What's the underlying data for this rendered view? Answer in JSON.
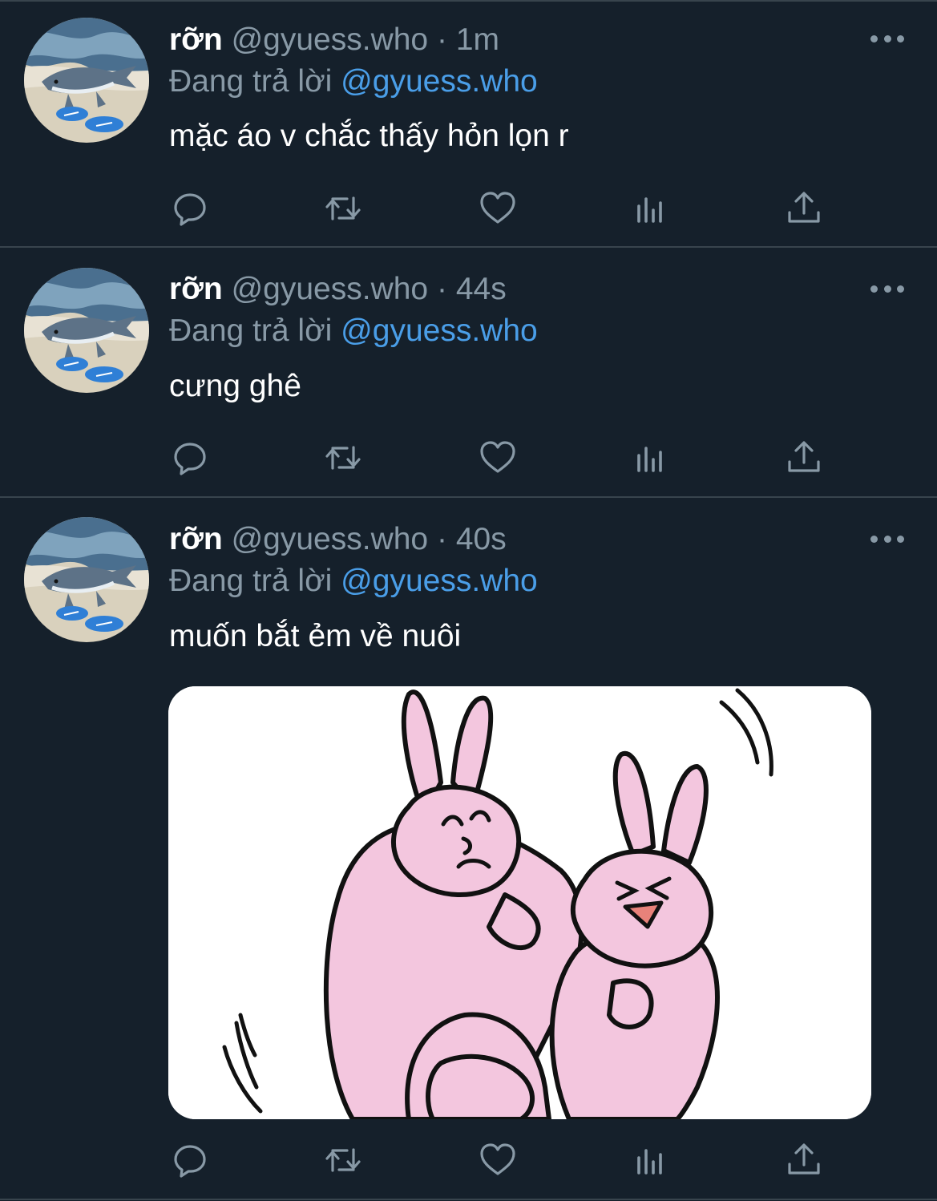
{
  "tweets": [
    {
      "name": "rỡn",
      "handle": "@gyuess.who",
      "sep": "·",
      "time": "1m",
      "replying_prefix": "Đang trả lời",
      "replying_to": "@gyuess.who",
      "text": "mặc áo v chắc thấy hỏn lọn r"
    },
    {
      "name": "rỡn",
      "handle": "@gyuess.who",
      "sep": "·",
      "time": "44s",
      "replying_prefix": "Đang trả lời",
      "replying_to": "@gyuess.who",
      "text": "cưng ghê"
    },
    {
      "name": "rỡn",
      "handle": "@gyuess.who",
      "sep": "·",
      "time": "40s",
      "replying_prefix": "Đang trả lời",
      "replying_to": "@gyuess.who",
      "text": "muốn bắt ẻm về nuôi",
      "media": "pink-bunnies-sticker"
    }
  ],
  "action_icons": [
    "reply-icon",
    "retweet-icon",
    "like-icon",
    "analytics-icon",
    "share-icon"
  ],
  "colors": {
    "background": "#15202b",
    "divider": "#38444d",
    "muted_text": "#8899a6",
    "mention": "#4a9ee8",
    "text": "#ffffff",
    "bunny_pink": "#f3c6de"
  }
}
